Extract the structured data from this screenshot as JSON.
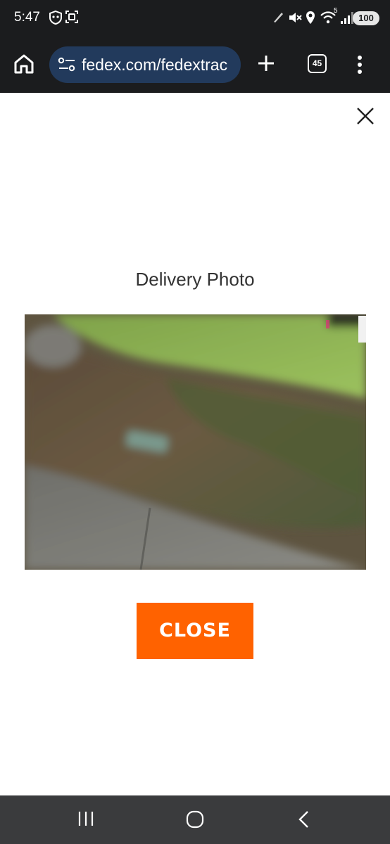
{
  "status_bar": {
    "time": "5:47",
    "network": "5",
    "battery": "100"
  },
  "browser": {
    "url": "fedex.com/fedextrac",
    "tab_count": "45"
  },
  "modal": {
    "title": "Delivery Photo",
    "close_button_label": "CLOSE"
  },
  "colors": {
    "accent": "#ff6200",
    "url_pill": "#223a5c",
    "chrome_bg": "#1b1c1e"
  }
}
